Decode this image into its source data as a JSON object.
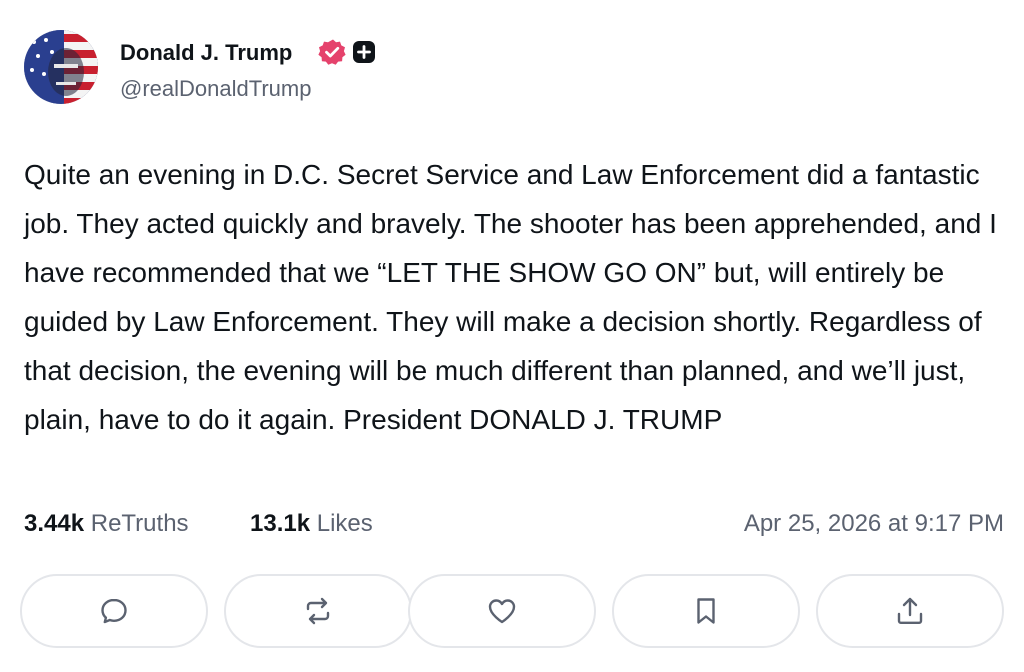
{
  "author": {
    "display_name": "Donald J. Trump",
    "handle": "@realDonaldTrump",
    "verified_color": "#e5426c"
  },
  "post": {
    "text": "Quite an evening in D.C. Secret Service and Law Enforcement did a fantastic job. They acted quickly and bravely. The shooter has been apprehended, and I have recommended that we “LET THE SHOW GO ON” but, will entirely be guided by Law Enforcement. They will make a decision shortly. Regardless of that decision, the evening will be much different than planned, and we’ll just, plain, have to do it again. President DONALD J. TRUMP"
  },
  "stats": {
    "retruths_count": "3.44k",
    "retruths_label": "ReTruths",
    "likes_count": "13.1k",
    "likes_label": "Likes",
    "timestamp": "Apr 25, 2026 at 9:17 PM"
  },
  "actions": [
    {
      "name": "reply",
      "icon": "speech-bubble-icon"
    },
    {
      "name": "retruth",
      "icon": "repost-arrows-icon"
    },
    {
      "name": "like",
      "icon": "heart-icon"
    },
    {
      "name": "bookmark",
      "icon": "bookmark-icon"
    },
    {
      "name": "share",
      "icon": "share-upload-icon"
    }
  ]
}
